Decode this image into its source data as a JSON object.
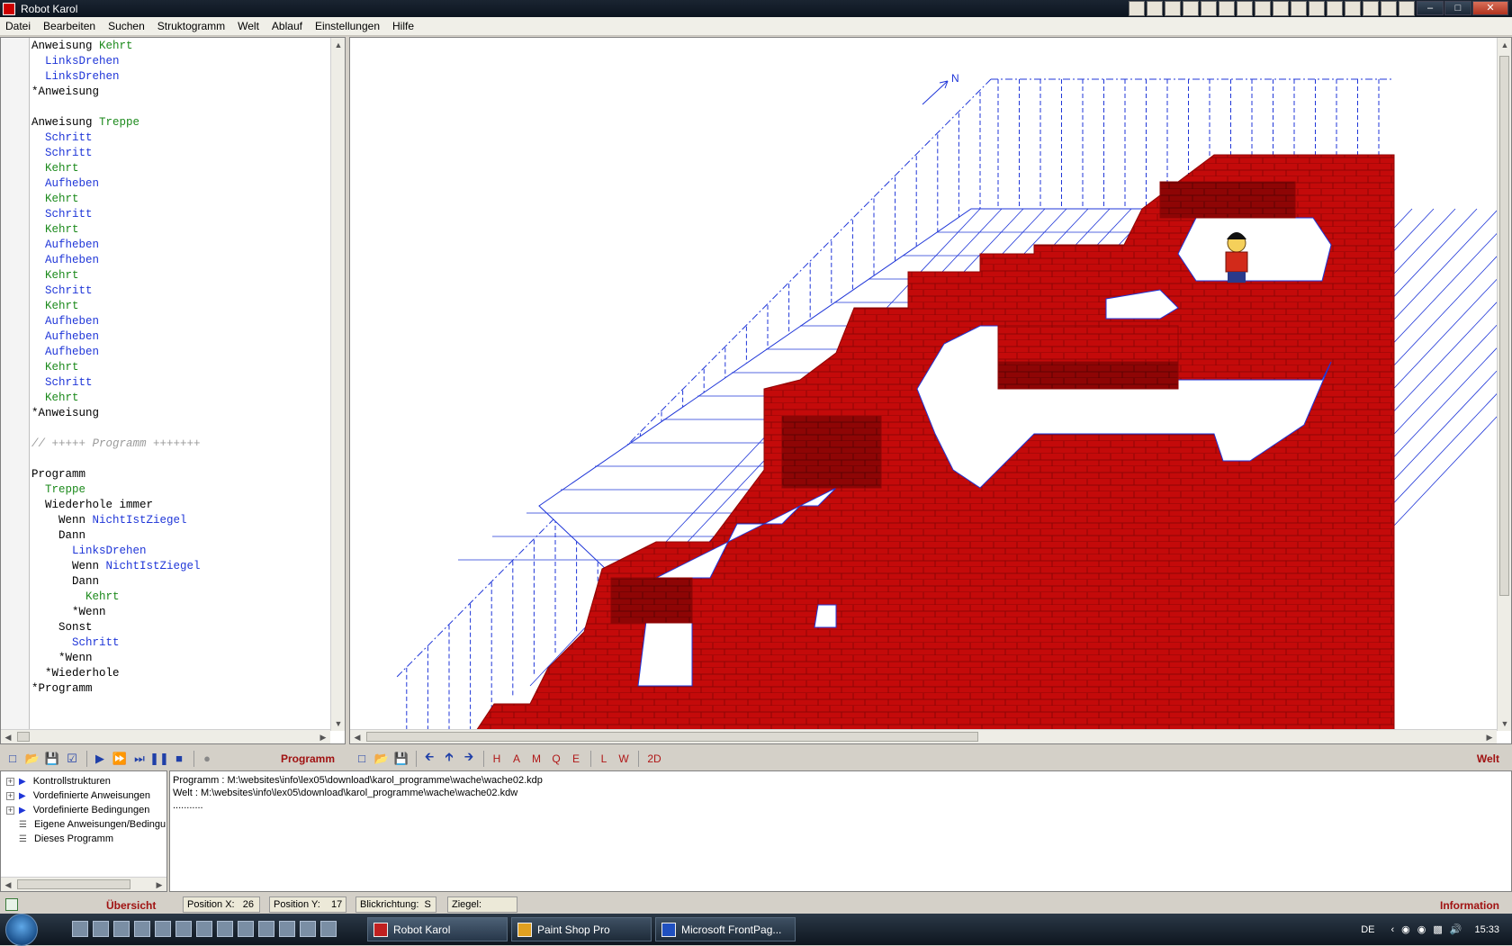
{
  "window": {
    "title": "Robot Karol"
  },
  "menu": [
    "Datei",
    "Bearbeiten",
    "Suchen",
    "Struktogramm",
    "Welt",
    "Ablauf",
    "Einstellungen",
    "Hilfe"
  ],
  "code": [
    [
      {
        "t": "Anweisung ",
        "c": "kw"
      },
      {
        "t": "Kehrt",
        "c": "def"
      }
    ],
    [
      {
        "t": "  LinksDrehen",
        "c": "cmd"
      }
    ],
    [
      {
        "t": "  LinksDrehen",
        "c": "cmd"
      }
    ],
    [
      {
        "t": "*Anweisung",
        "c": "kw"
      }
    ],
    [],
    [
      {
        "t": "Anweisung ",
        "c": "kw"
      },
      {
        "t": "Treppe",
        "c": "def"
      }
    ],
    [
      {
        "t": "  Schritt",
        "c": "cmd"
      }
    ],
    [
      {
        "t": "  Schritt",
        "c": "cmd"
      }
    ],
    [
      {
        "t": "  Kehrt",
        "c": "def"
      }
    ],
    [
      {
        "t": "  Aufheben",
        "c": "cmd"
      }
    ],
    [
      {
        "t": "  Kehrt",
        "c": "def"
      }
    ],
    [
      {
        "t": "  Schritt",
        "c": "cmd"
      }
    ],
    [
      {
        "t": "  Kehrt",
        "c": "def"
      }
    ],
    [
      {
        "t": "  Aufheben",
        "c": "cmd"
      }
    ],
    [
      {
        "t": "  Aufheben",
        "c": "cmd"
      }
    ],
    [
      {
        "t": "  Kehrt",
        "c": "def"
      }
    ],
    [
      {
        "t": "  Schritt",
        "c": "cmd"
      }
    ],
    [
      {
        "t": "  Kehrt",
        "c": "def"
      }
    ],
    [
      {
        "t": "  Aufheben",
        "c": "cmd"
      }
    ],
    [
      {
        "t": "  Aufheben",
        "c": "cmd"
      }
    ],
    [
      {
        "t": "  Aufheben",
        "c": "cmd"
      }
    ],
    [
      {
        "t": "  Kehrt",
        "c": "def"
      }
    ],
    [
      {
        "t": "  Schritt",
        "c": "cmd"
      }
    ],
    [
      {
        "t": "  Kehrt",
        "c": "def"
      }
    ],
    [
      {
        "t": "*Anweisung",
        "c": "kw"
      }
    ],
    [],
    [
      {
        "t": "// +++++ Programm +++++++",
        "c": "cmt"
      }
    ],
    [],
    [
      {
        "t": "Programm",
        "c": "kw"
      }
    ],
    [
      {
        "t": "  Treppe",
        "c": "def"
      }
    ],
    [
      {
        "t": "  Wiederhole immer",
        "c": "kw"
      }
    ],
    [
      {
        "t": "    Wenn ",
        "c": "kw"
      },
      {
        "t": "NichtIstZiegel",
        "c": "cmd"
      }
    ],
    [
      {
        "t": "    Dann",
        "c": "kw"
      }
    ],
    [
      {
        "t": "      LinksDrehen",
        "c": "cmd"
      }
    ],
    [
      {
        "t": "      Wenn ",
        "c": "kw"
      },
      {
        "t": "NichtIstZiegel",
        "c": "cmd"
      }
    ],
    [
      {
        "t": "      Dann",
        "c": "kw"
      }
    ],
    [
      {
        "t": "        Kehrt",
        "c": "def"
      }
    ],
    [
      {
        "t": "      *Wenn",
        "c": "kw"
      }
    ],
    [
      {
        "t": "    Sonst",
        "c": "kw"
      }
    ],
    [
      {
        "t": "      Schritt",
        "c": "cmd"
      }
    ],
    [
      {
        "t": "    *Wenn",
        "c": "kw"
      }
    ],
    [
      {
        "t": "  *Wiederhole",
        "c": "kw"
      }
    ],
    [
      {
        "t": "*Programm",
        "c": "kw"
      }
    ]
  ],
  "toolbar": {
    "program_label": "Programm",
    "world_label": "Welt",
    "world_letters": [
      "H",
      "A",
      "M",
      "Q",
      "E",
      "L",
      "W",
      "2D"
    ]
  },
  "world": {
    "compass": "N"
  },
  "tree": [
    {
      "label": "Kontrollstrukturen",
      "expandable": true
    },
    {
      "label": "Vordefinierte Anweisungen",
      "expandable": true
    },
    {
      "label": "Vordefinierte Bedingungen",
      "expandable": true
    },
    {
      "label": "Eigene Anweisungen/Bedingu",
      "expandable": false
    },
    {
      "label": "Dieses Programm",
      "expandable": false
    }
  ],
  "info_lines": [
    "Programm : M:\\websites\\info\\lex05\\download\\karol_programme\\wache\\wache02.kdp",
    "Welt : M:\\websites\\info\\lex05\\download\\karol_programme\\wache\\wache02.kdw",
    "..........."
  ],
  "status": {
    "overview_label": "Übersicht",
    "pos_x_label": "Position X:",
    "pos_x": "26",
    "pos_y_label": "Position Y:",
    "pos_y": "17",
    "direction_label": "Blickrichtung:",
    "direction": "S",
    "bricks_label": "Ziegel:",
    "bricks": "",
    "info_label": "Information"
  },
  "taskbar": {
    "tasks": [
      "Robot Karol",
      "Paint Shop Pro",
      "Microsoft FrontPag..."
    ],
    "lang": "DE",
    "clock": "15:33"
  },
  "colors": {
    "brick": "#c40a0a",
    "brick_dark": "#8e0505",
    "grid": "#1f36d8",
    "accent_label": "#a01212"
  }
}
